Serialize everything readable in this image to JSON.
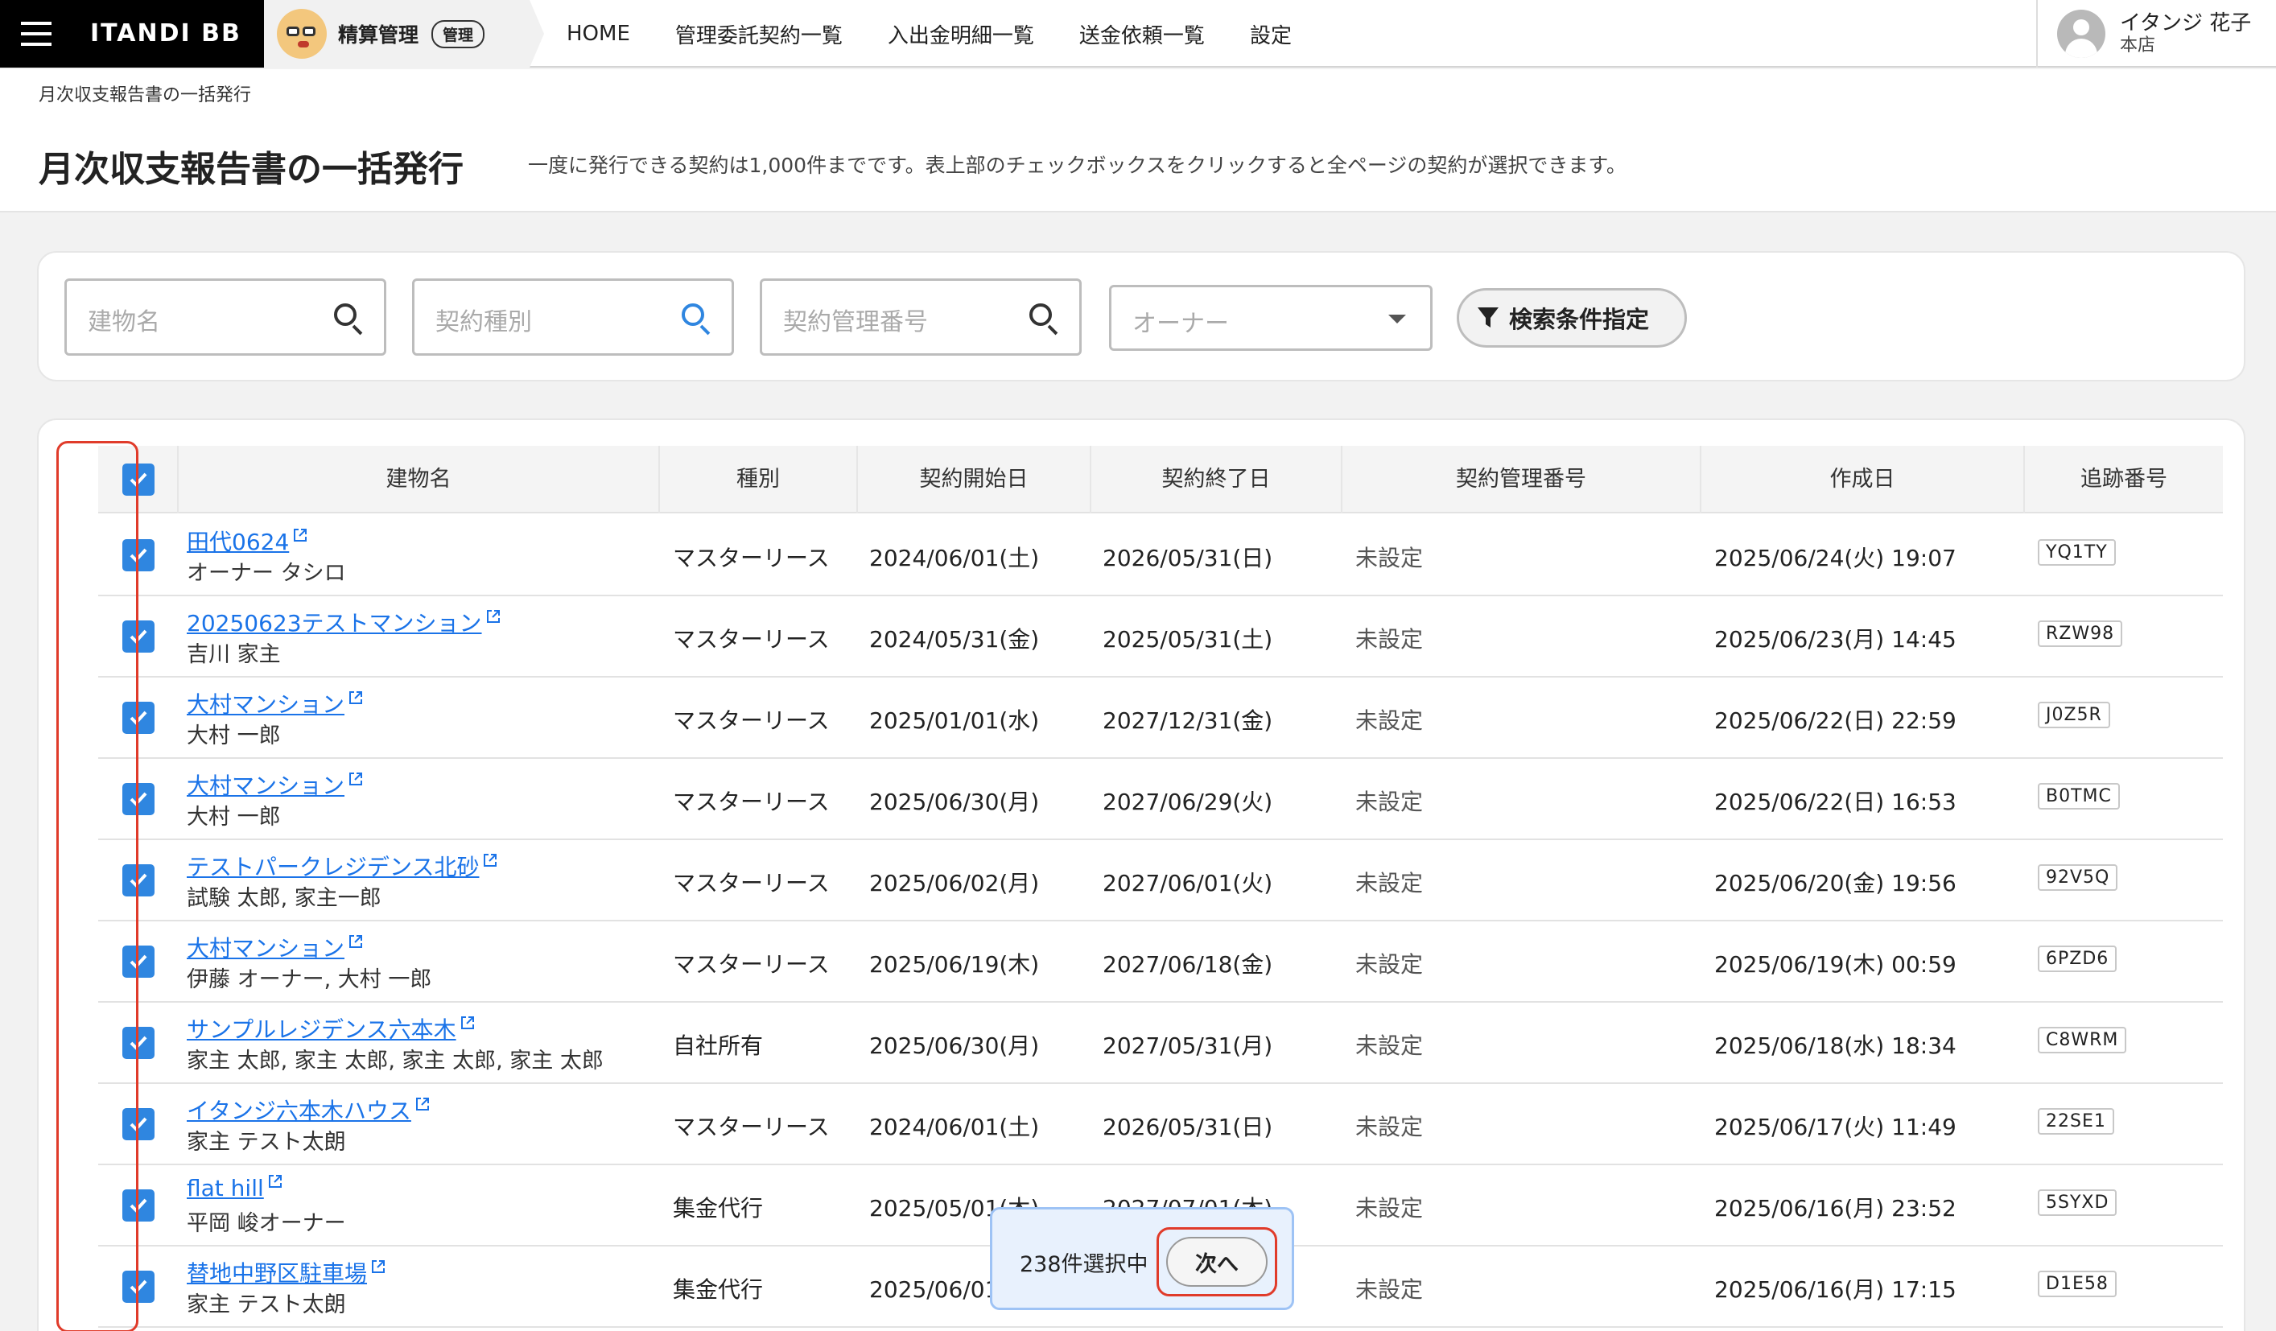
{
  "brand": {
    "logo": "ITANDI BB",
    "product": "精算管理",
    "badge": "管理"
  },
  "nav": [
    "HOME",
    "管理委託契約一覧",
    "入出金明細一覧",
    "送金依頼一覧",
    "設定"
  ],
  "user": {
    "name": "イタンジ 花子",
    "branch": "本店"
  },
  "breadcrumb": "月次収支報告書の一括発行",
  "page": {
    "title": "月次収支報告書の一括発行",
    "description": "一度に発行できる契約は1,000件までです。表上部のチェックボックスをクリックすると全ページの契約が選択できます。"
  },
  "search": {
    "building_placeholder": "建物名",
    "contract_type_placeholder": "契約種別",
    "contract_no_placeholder": "契約管理番号",
    "owner_placeholder": "オーナー",
    "filter_label": "検索条件指定"
  },
  "table": {
    "columns": [
      "建物名",
      "種別",
      "契約開始日",
      "契約終了日",
      "契約管理番号",
      "作成日",
      "追跡番号"
    ],
    "rows": [
      {
        "building": "田代0624",
        "owner": "オーナー タシロ",
        "type": "マスターリース",
        "start": "2024/06/01(土)",
        "end": "2026/05/31(日)",
        "mgmt_no": "未設定",
        "created": "2025/06/24(火) 19:07",
        "tracking": "YQ1TY"
      },
      {
        "building": "20250623テストマンション",
        "owner": "吉川 家主",
        "type": "マスターリース",
        "start": "2024/05/31(金)",
        "end": "2025/05/31(土)",
        "mgmt_no": "未設定",
        "created": "2025/06/23(月) 14:45",
        "tracking": "RZW98"
      },
      {
        "building": "大村マンション",
        "owner": "大村 一郎",
        "type": "マスターリース",
        "start": "2025/01/01(水)",
        "end": "2027/12/31(金)",
        "mgmt_no": "未設定",
        "created": "2025/06/22(日) 22:59",
        "tracking": "J0Z5R"
      },
      {
        "building": "大村マンション",
        "owner": "大村 一郎",
        "type": "マスターリース",
        "start": "2025/06/30(月)",
        "end": "2027/06/29(火)",
        "mgmt_no": "未設定",
        "created": "2025/06/22(日) 16:53",
        "tracking": "B0TMC"
      },
      {
        "building": "テストパークレジデンス北砂",
        "owner": "試験 太郎, 家主一郎",
        "type": "マスターリース",
        "start": "2025/06/02(月)",
        "end": "2027/06/01(火)",
        "mgmt_no": "未設定",
        "created": "2025/06/20(金) 19:56",
        "tracking": "92V5Q"
      },
      {
        "building": "大村マンション",
        "owner": "伊藤 オーナー, 大村 一郎",
        "type": "マスターリース",
        "start": "2025/06/19(木)",
        "end": "2027/06/18(金)",
        "mgmt_no": "未設定",
        "created": "2025/06/19(木) 00:59",
        "tracking": "6PZD6"
      },
      {
        "building": "サンプルレジデンス六本木",
        "owner": "家主 太郎, 家主 太郎, 家主 太郎, 家主 太郎",
        "type": "自社所有",
        "start": "2025/06/30(月)",
        "end": "2027/05/31(月)",
        "mgmt_no": "未設定",
        "created": "2025/06/18(水) 18:34",
        "tracking": "C8WRM"
      },
      {
        "building": "イタンジ六本木ハウス",
        "owner": "家主 テスト太朗",
        "type": "マスターリース",
        "start": "2024/06/01(土)",
        "end": "2026/05/31(日)",
        "mgmt_no": "未設定",
        "created": "2025/06/17(火) 11:49",
        "tracking": "22SE1"
      },
      {
        "building": "flat hill",
        "owner": "平岡 峻オーナー",
        "type": "集金代行",
        "start": "2025/05/01(木)",
        "end": "2027/07/01(木)",
        "mgmt_no": "未設定",
        "created": "2025/06/16(月) 23:52",
        "tracking": "5SYXD"
      },
      {
        "building": "替地中野区駐車場",
        "owner": "家主 テスト太朗",
        "type": "集金代行",
        "start": "2025/06/01(日)",
        "end": "",
        "mgmt_no": "未設定",
        "created": "2025/06/16(月) 17:15",
        "tracking": "D1E58"
      }
    ]
  },
  "selection": {
    "count_label": "238件選択中",
    "next_label": "次へ"
  },
  "colors": {
    "accent": "#2f86e0",
    "highlight": "#e03b2a",
    "link": "#1a73e8"
  }
}
